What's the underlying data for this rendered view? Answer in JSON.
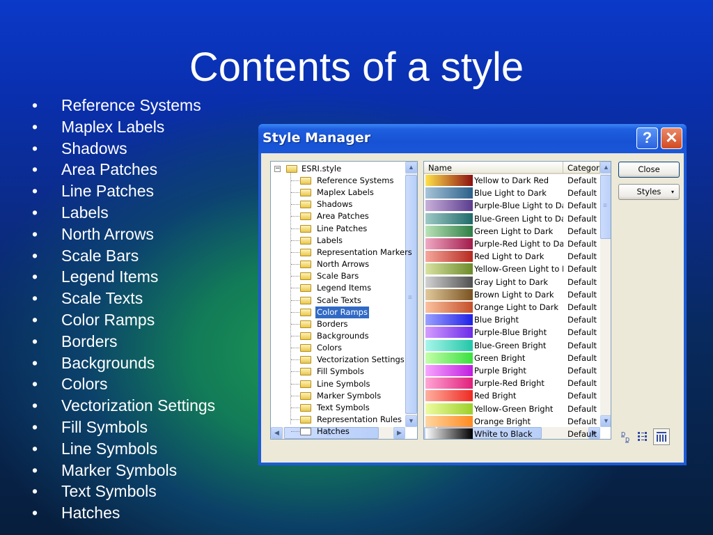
{
  "slide": {
    "title": "Contents of a style",
    "bullet_symbol": "•",
    "bullets": [
      "Reference Systems",
      "Maplex Labels",
      "Shadows",
      "Area Patches",
      "Line Patches",
      "Labels",
      "North Arrows",
      "Scale Bars",
      "Legend Items",
      "Scale Texts",
      "Color Ramps",
      "Borders",
      "Backgrounds",
      "Colors",
      "Vectorization Settings",
      "Fill Symbols",
      "Line Symbols",
      "Marker Symbols",
      "Text Symbols",
      "Hatches"
    ]
  },
  "window": {
    "title": "Style Manager",
    "help_glyph": "?",
    "close_glyph": "✕",
    "tree": {
      "root": "ESRI.style",
      "expander": "−",
      "selected": "Color Ramps",
      "items": [
        "Reference Systems",
        "Maplex Labels",
        "Shadows",
        "Area Patches",
        "Line Patches",
        "Labels",
        "Representation Markers",
        "North Arrows",
        "Scale Bars",
        "Legend Items",
        "Scale Texts",
        "Color Ramps",
        "Borders",
        "Backgrounds",
        "Colors",
        "Vectorization Settings",
        "Fill Symbols",
        "Line Symbols",
        "Marker Symbols",
        "Text Symbols",
        "Representation Rules",
        "Hatches"
      ]
    },
    "list": {
      "columns": [
        "Name",
        "Category"
      ],
      "rows": [
        {
          "name": "Yellow to Dark Red",
          "category": "Default Ramps",
          "c1": "#ffe24a",
          "c2": "#8c1010"
        },
        {
          "name": "Blue Light to Dark",
          "category": "Default Ramps",
          "c1": "#a8c4d8",
          "c2": "#2a5f8a"
        },
        {
          "name": "Purple-Blue Light to Dark",
          "category": "Default Ramps",
          "c1": "#c9b0da",
          "c2": "#5a3c8e"
        },
        {
          "name": "Blue-Green Light to Dark",
          "category": "Default Ramps",
          "c1": "#9ec9c6",
          "c2": "#1f6b6a"
        },
        {
          "name": "Green Light to Dark",
          "category": "Default Ramps",
          "c1": "#b9e3b8",
          "c2": "#2f7e46"
        },
        {
          "name": "Purple-Red Light to Dark",
          "category": "Default Ramps",
          "c1": "#f0a9c4",
          "c2": "#a21a4a"
        },
        {
          "name": "Red Light to Dark",
          "category": "Default Ramps",
          "c1": "#f6a79c",
          "c2": "#b52a20"
        },
        {
          "name": "Yellow-Green Light to Dark",
          "category": "Default Ramps",
          "c1": "#d8e2a0",
          "c2": "#6c8b2a"
        },
        {
          "name": "Gray Light to Dark",
          "category": "Default Ramps",
          "c1": "#d2d2d2",
          "c2": "#505050"
        },
        {
          "name": "Brown Light to Dark",
          "category": "Default Ramps",
          "c1": "#e1c99b",
          "c2": "#7a5220"
        },
        {
          "name": "Orange Light to Dark",
          "category": "Default Ramps",
          "c1": "#fbc2a0",
          "c2": "#c4502a"
        },
        {
          "name": "Blue Bright",
          "category": "Default Ramps",
          "c1": "#9aa0ff",
          "c2": "#2020e6"
        },
        {
          "name": "Purple-Blue Bright",
          "category": "Default Ramps",
          "c1": "#d59cff",
          "c2": "#6a2ce8"
        },
        {
          "name": "Blue-Green Bright",
          "category": "Default Ramps",
          "c1": "#a8f6ea",
          "c2": "#22c6a8"
        },
        {
          "name": "Green Bright",
          "category": "Default Ramps",
          "c1": "#c4ffa8",
          "c2": "#3ae040"
        },
        {
          "name": "Purple Bright",
          "category": "Default Ramps",
          "c1": "#f7a6ff",
          "c2": "#c01ee0"
        },
        {
          "name": "Purple-Red Bright",
          "category": "Default Ramps",
          "c1": "#ffa6d6",
          "c2": "#e0207a"
        },
        {
          "name": "Red Bright",
          "category": "Default Ramps",
          "c1": "#ffb0a0",
          "c2": "#ee2a22"
        },
        {
          "name": "Yellow-Green Bright",
          "category": "Default Ramps",
          "c1": "#eefca0",
          "c2": "#9cd02a"
        },
        {
          "name": "Orange Bright",
          "category": "Default Ramps",
          "c1": "#ffd6a0",
          "c2": "#ff8a20"
        },
        {
          "name": "White to Black",
          "category": "Default Ramps",
          "c1": "#ffffff",
          "c2": "#000000"
        }
      ]
    },
    "buttons": {
      "close": "Close",
      "styles": "Styles",
      "styles_arrow": "▾"
    },
    "scroll": {
      "up": "▲",
      "down": "▼",
      "left": "◀",
      "right": "▶",
      "grip": "≡",
      "hgrip": "|||"
    },
    "view_buttons": [
      "details-view",
      "list-view",
      "grid-view"
    ]
  }
}
